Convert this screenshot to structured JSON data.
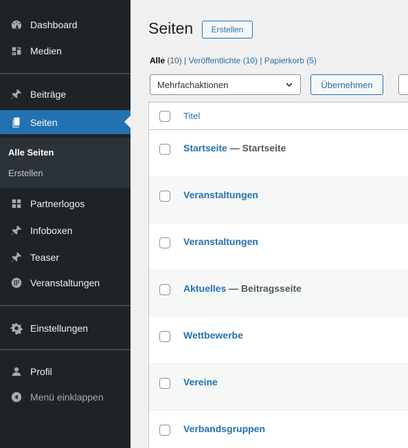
{
  "sidebar": {
    "items": [
      {
        "label": "Dashboard",
        "icon": "dashboard-icon"
      },
      {
        "label": "Medien",
        "icon": "media-icon"
      },
      {
        "label": "Beiträge",
        "icon": "pin-icon"
      },
      {
        "label": "Seiten",
        "icon": "pages-icon"
      },
      {
        "label": "Partnerlogos",
        "icon": "grid-icon"
      },
      {
        "label": "Infoboxen",
        "icon": "pin-icon"
      },
      {
        "label": "Teaser",
        "icon": "pin-icon"
      },
      {
        "label": "Veranstaltungen",
        "icon": "calendar-icon"
      },
      {
        "label": "Einstellungen",
        "icon": "settings-icon"
      },
      {
        "label": "Profil",
        "icon": "user-icon"
      },
      {
        "label": "Menü einklappen",
        "icon": "collapse-icon"
      }
    ],
    "submenu": [
      {
        "label": "Alle Seiten"
      },
      {
        "label": "Erstellen"
      }
    ]
  },
  "header": {
    "title": "Seiten",
    "add_button": "Erstellen"
  },
  "filters": {
    "all_label": "Alle",
    "all_count": "(10)",
    "sep1": "|",
    "published_label": "Veröffentlichte",
    "published_count": "(10)",
    "sep2": "|",
    "trash_label": "Papierkorb",
    "trash_count": "(5)"
  },
  "bulk": {
    "selected": "Mehrfachaktionen",
    "apply": "Übernehmen"
  },
  "table": {
    "column_title": "Titel",
    "rows": [
      {
        "title": "Startseite",
        "state": " — Startseite"
      },
      {
        "title": "Veranstaltungen",
        "state": ""
      },
      {
        "title": "Veranstaltungen",
        "state": ""
      },
      {
        "title": "Aktuelles",
        "state": " — Beitragsseite"
      },
      {
        "title": "Wettbewerbe",
        "state": ""
      },
      {
        "title": "Vereine",
        "state": ""
      },
      {
        "title": "Verbandsgruppen",
        "state": ""
      }
    ]
  },
  "colors": {
    "sidebar_bg": "#1d2327",
    "active_bg": "#2271b1",
    "link": "#2271b1",
    "page_bg": "#f0f0f1"
  }
}
